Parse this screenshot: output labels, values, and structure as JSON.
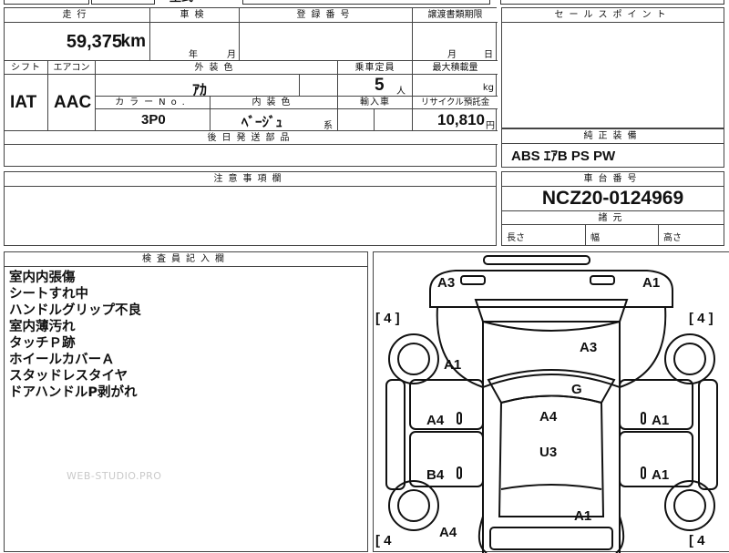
{
  "top_row_fragments": {
    "left": "",
    "middle_glyph": "型式",
    "right_glyph": "の"
  },
  "info_table": {
    "headers": {
      "mileage": "走行",
      "inspection": "車検",
      "registration": "登録番号",
      "transfer_deadline": "譲渡書類期限",
      "shift": "シフト",
      "aircon": "エアコン",
      "exterior_color": "外装色",
      "capacity": "乗車定員",
      "max_load": "最大積載量",
      "color_no": "カラーNo.",
      "interior_color": "内装色",
      "import": "輸入車",
      "recycle": "リサイクル預託金",
      "later_parts": "後日発送部品"
    },
    "values": {
      "mileage": "59,375",
      "mileage_unit": "km",
      "inspection_year": "年",
      "inspection_month": "月",
      "registration": "",
      "transfer_month": "月",
      "transfer_day": "日",
      "shift": "IAT",
      "aircon": "AAC",
      "exterior_color": "ｱｶ",
      "capacity": "5",
      "capacity_unit": "人",
      "max_load_unit": "kg",
      "color_no": "3P0",
      "interior_color": "ﾍﾞｰｼﾞｭ",
      "interior_suffix": "系",
      "recycle": "10,810",
      "recycle_unit": "円",
      "later_parts": ""
    }
  },
  "sales_point": {
    "header": "セールスポイント",
    "text": ""
  },
  "genuine_equipment": {
    "header": "純正装備",
    "value": "ABS ｴｱB PS PW"
  },
  "notes": {
    "header": "注意事項欄",
    "text": ""
  },
  "chassis": {
    "header": "車台番号",
    "value": "NCZ20-0124969"
  },
  "dimensions": {
    "header": "諸元",
    "length": "長さ",
    "width": "幅",
    "height": "高さ"
  },
  "inspector": {
    "header": "検査員記入欄",
    "lines": [
      "室内内張傷",
      "シートすれ中",
      "ハンドルグリップ不良",
      "室内薄汚れ",
      "タッチＰ跡",
      "ホイールカバーＡ",
      "スタッドレスタイヤ",
      "ドアハンドルP剥がれ"
    ],
    "watermark": "WEB-STUDIO.PRO"
  },
  "car_diagram": {
    "marks": {
      "front_left": "A3",
      "front_right": "A1",
      "tire_fl": "[ 4 ]",
      "tire_fr": "[ 4 ]",
      "tire_rl": "[ 4",
      "tire_rr": "[ 4",
      "fender_left": "A1",
      "hood": "A3",
      "windshield": "G",
      "front_door_left": "A4",
      "roof": "A4",
      "front_door_right": "A1",
      "rear_door_left": "B4",
      "rear_roof": "U3",
      "rear_door_right": "A1",
      "quarter_left": "A4",
      "rear_right": "A1"
    }
  }
}
